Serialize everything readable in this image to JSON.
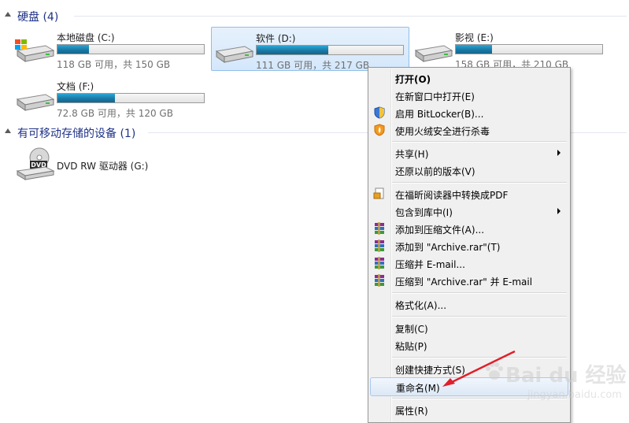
{
  "hard_disks": {
    "header": "硬盘 (4)",
    "drives": [
      {
        "name": "本地磁盘 (C:)",
        "space": "118 GB 可用，共 150 GB",
        "used_fraction": 0.213,
        "selected": false
      },
      {
        "name": "软件 (D:)",
        "space": "111 GB 可用，共 217 GB",
        "used_fraction": 0.488,
        "selected": true
      },
      {
        "name": "影视 (E:)",
        "space": "158 GB 可用，共 210 GB",
        "used_fraction": 0.248,
        "selected": false
      },
      {
        "name": "文档 (F:)",
        "space": "72.8 GB 可用，共 120 GB",
        "used_fraction": 0.393,
        "selected": false
      }
    ]
  },
  "removable": {
    "header": "有可移动存储的设备 (1)",
    "drives": [
      {
        "name": "DVD RW 驱动器 (G:)",
        "icon_label": "DVD"
      }
    ]
  },
  "context_menu": {
    "items": [
      {
        "label": "打开(O)",
        "bold": true
      },
      {
        "label": "在新窗口中打开(E)"
      },
      {
        "label": "启用 BitLocker(B)...",
        "icon": "shield-icon"
      },
      {
        "label": "使用火绒安全进行杀毒",
        "icon": "huorong-icon"
      },
      {
        "label": "共享(H)",
        "submenu": true
      },
      {
        "label": "还原以前的版本(V)"
      },
      {
        "label": "在福昕阅读器中转换成PDF",
        "icon": "pdf-icon"
      },
      {
        "label": "包含到库中(I)",
        "submenu": true
      },
      {
        "label": "添加到压缩文件(A)...",
        "icon": "winrar-icon"
      },
      {
        "label": "添加到 \"Archive.rar\"(T)",
        "icon": "winrar-icon"
      },
      {
        "label": "压缩并 E-mail...",
        "icon": "winrar-icon"
      },
      {
        "label": "压缩到 \"Archive.rar\" 并 E-mail",
        "icon": "winrar-icon"
      },
      {
        "label": "格式化(A)..."
      },
      {
        "label": "复制(C)"
      },
      {
        "label": "粘贴(P)"
      },
      {
        "label": "创建快捷方式(S)"
      },
      {
        "label": "重命名(M)",
        "highlighted": true
      },
      {
        "label": "属性(R)"
      }
    ]
  },
  "watermark": {
    "brand": "Bai du 经验",
    "url": "jingyan.baidu.com"
  },
  "colors": {
    "accent_bar": "#1b7aa5",
    "header_text": "#1e3287",
    "annotation_arrow": "#e0202a"
  }
}
